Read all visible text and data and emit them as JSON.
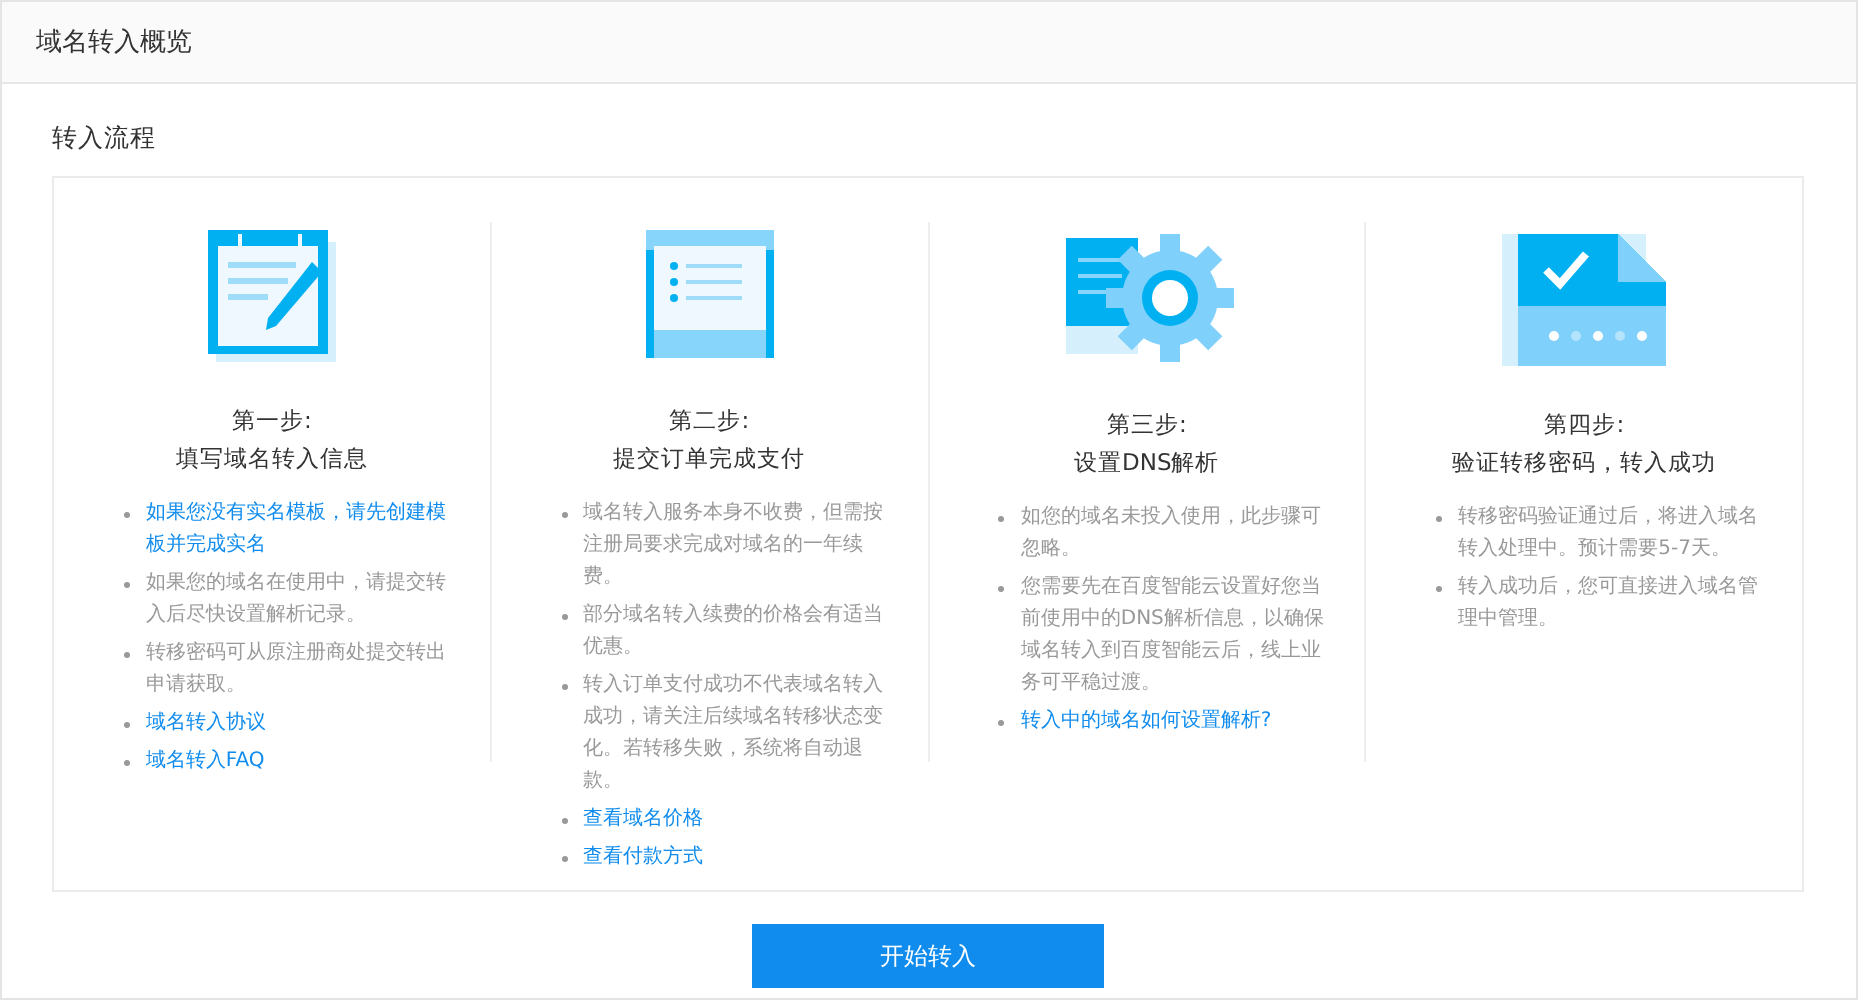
{
  "header": {
    "title": "域名转入概览"
  },
  "section": {
    "title": "转入流程"
  },
  "steps": [
    {
      "kind": "form",
      "step": "第一步:",
      "title": "填写域名转入信息",
      "items": [
        {
          "kind": "link",
          "text": "如果您没有实名模板，请先创建模板并完成实名"
        },
        {
          "kind": "text",
          "text": "如果您的域名在使用中，请提交转入后尽快设置解析记录。"
        },
        {
          "kind": "text",
          "text": "转移密码可从原注册商处提交转出申请获取。"
        },
        {
          "kind": "link",
          "text": "域名转入协议"
        },
        {
          "kind": "link",
          "text": "域名转入FAQ"
        }
      ]
    },
    {
      "kind": "order",
      "step": "第二步:",
      "title": "提交订单完成支付",
      "items": [
        {
          "kind": "text",
          "text": "域名转入服务本身不收费，但需按注册局要求完成对域名的一年续费。"
        },
        {
          "kind": "text",
          "text": "部分域名转入续费的价格会有适当优惠。"
        },
        {
          "kind": "text",
          "text": "转入订单支付成功不代表域名转入成功，请关注后续域名转移状态变化。若转移失败，系统将自动退款。"
        },
        {
          "kind": "link",
          "text": "查看域名价格"
        },
        {
          "kind": "link",
          "text": "查看付款方式"
        }
      ]
    },
    {
      "kind": "dns",
      "step": "第三步:",
      "title": "设置DNS解析",
      "items": [
        {
          "kind": "text",
          "text": "如您的域名未投入使用，此步骤可忽略。"
        },
        {
          "kind": "text",
          "text": "您需要先在百度智能云设置好您当前使用中的DNS解析信息，以确保域名转入到百度智能云后，线上业务可平稳过渡。"
        },
        {
          "kind": "link",
          "text": "转入中的域名如何设置解析?"
        }
      ]
    },
    {
      "kind": "verify",
      "step": "第四步:",
      "title": "验证转移密码，转入成功",
      "items": [
        {
          "kind": "text",
          "text": "转移密码验证通过后，将进入域名转入处理中。预计需要5-7天。"
        },
        {
          "kind": "text",
          "text": "转入成功后，您可直接进入域名管理中管理。"
        }
      ]
    }
  ],
  "button": {
    "label": "开始转入"
  }
}
